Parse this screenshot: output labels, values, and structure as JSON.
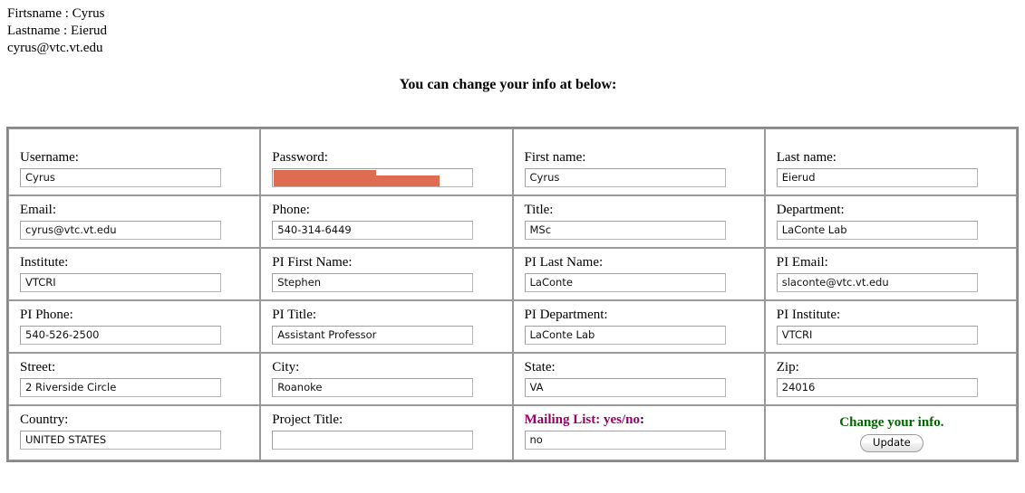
{
  "identity": {
    "firstname_line": "Firtsname : Cyrus",
    "lastname_line": "Lastname : Eierud",
    "email_line": "cyrus@vtc.vt.edu"
  },
  "heading": "You can change your info at below:",
  "colors": {
    "mailing_label": "#99006b",
    "update_title": "#006400",
    "redaction_bar": "#dd6c50",
    "table_border": "#888888",
    "cell_border": "#9a9a9a"
  },
  "form": {
    "rows": [
      [
        {
          "label": "Username:",
          "value": "Cyrus",
          "name": "username"
        },
        {
          "label": "Password:",
          "value": "",
          "name": "password",
          "redacted": true
        },
        {
          "label": "First name:",
          "value": "Cyrus",
          "name": "first-name"
        },
        {
          "label": "Last name:",
          "value": "Eierud",
          "name": "last-name"
        }
      ],
      [
        {
          "label": "Email:",
          "value": "cyrus@vtc.vt.edu",
          "name": "email"
        },
        {
          "label": "Phone:",
          "value": "540-314-6449",
          "name": "phone"
        },
        {
          "label": "Title:",
          "value": "MSc",
          "name": "title"
        },
        {
          "label": "Department:",
          "value": "LaConte Lab",
          "name": "department"
        }
      ],
      [
        {
          "label": "Institute:",
          "value": "VTCRI",
          "name": "institute"
        },
        {
          "label": "PI First Name:",
          "value": "Stephen",
          "name": "pi-first-name"
        },
        {
          "label": "PI Last Name:",
          "value": "LaConte",
          "name": "pi-last-name"
        },
        {
          "label": "PI Email:",
          "value": "slaconte@vtc.vt.edu",
          "name": "pi-email"
        }
      ],
      [
        {
          "label": "PI Phone:",
          "value": "540-526-2500",
          "name": "pi-phone"
        },
        {
          "label": "PI Title:",
          "value": "Assistant Professor",
          "name": "pi-title"
        },
        {
          "label": "PI Department:",
          "value": "LaConte Lab",
          "name": "pi-department"
        },
        {
          "label": "PI Institute:",
          "value": "VTCRI",
          "name": "pi-institute"
        }
      ],
      [
        {
          "label": "Street:",
          "value": "2 Riverside Circle",
          "name": "street"
        },
        {
          "label": "City:",
          "value": "Roanoke",
          "name": "city"
        },
        {
          "label": "State:",
          "value": "VA",
          "name": "state"
        },
        {
          "label": "Zip:",
          "value": "24016",
          "name": "zip"
        }
      ]
    ],
    "last_row": {
      "country": {
        "label": "Country:",
        "value": "UNITED STATES"
      },
      "project_title": {
        "label": "Project Title:",
        "value": ""
      },
      "mailing_list": {
        "label": "Mailing List: yes/no",
        "colon": ":",
        "value": "no"
      },
      "update": {
        "title": "Change your info.",
        "button_label": "Update"
      }
    }
  }
}
